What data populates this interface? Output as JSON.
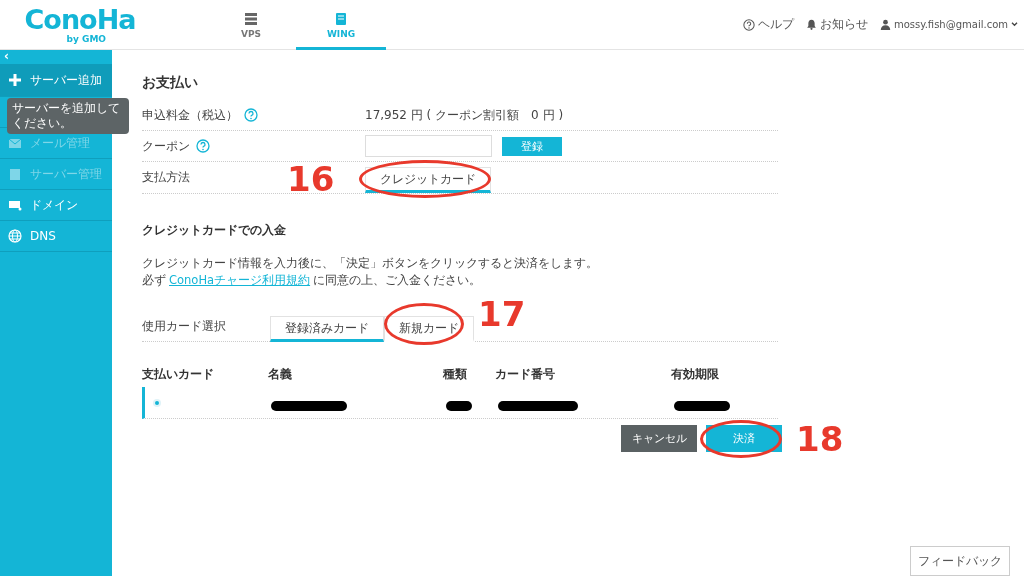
{
  "header": {
    "logo": "ConoHa",
    "logo_sub": "by GMO",
    "tabs": [
      {
        "label": "VPS",
        "selected": false
      },
      {
        "label": "WING",
        "selected": true
      }
    ],
    "links": [
      {
        "kind": "help",
        "label": "ヘルプ"
      },
      {
        "kind": "notice",
        "label": "お知らせ"
      },
      {
        "kind": "user",
        "label": "mossy.fish@gmail.com"
      }
    ]
  },
  "sidebar": {
    "collapse": "‹",
    "items": [
      {
        "kind": "plus",
        "label": "サーバー追加",
        "selected": true,
        "disabled": false
      },
      {
        "kind": "mail",
        "label": "メール管理",
        "selected": false,
        "disabled": true
      },
      {
        "kind": "server",
        "label": "サーバー管理",
        "selected": false,
        "disabled": true
      },
      {
        "kind": "domain",
        "label": "ドメイン",
        "selected": false,
        "disabled": false
      },
      {
        "kind": "globe",
        "label": "DNS",
        "selected": false,
        "disabled": false
      }
    ],
    "tooltip": "サーバーを追加してください。"
  },
  "main": {
    "title": "お支払い",
    "fee": {
      "label": "申込料金（税込）",
      "value": "17,952 円 ( クーポン割引額　0 円 )"
    },
    "coupon": {
      "label": "クーポン",
      "button": "登録"
    },
    "method": {
      "label": "支払方法",
      "tabs": [
        {
          "label": "クレジットカード",
          "selected": true,
          "annotation": "16"
        }
      ]
    },
    "section_title": "クレジットカードでの入金",
    "notice_line1": "クレジットカード情報を入力後に、「決定」ボタンをクリックすると決済をします。",
    "notice_pre": "必ず",
    "notice_link": "ConoHaチャージ利用規約",
    "notice_post": "に同意の上、ご入金ください。",
    "card_select": {
      "label": "使用カード選択",
      "tabs": [
        {
          "label": "登録済みカード",
          "selected": true
        },
        {
          "label": "新規カード",
          "selected": false,
          "annotation": "17"
        }
      ]
    },
    "table": {
      "columns": [
        "支払いカード",
        "名義",
        "種類",
        "カード番号",
        "有効期限"
      ],
      "rows": [
        {
          "selected": true,
          "redacted": true
        }
      ]
    },
    "buttons": [
      {
        "kind": "cancel",
        "label": "キャンセル"
      },
      {
        "kind": "primary",
        "label": "決済",
        "annotation": "18"
      }
    ]
  },
  "feedback": "フィードバック"
}
